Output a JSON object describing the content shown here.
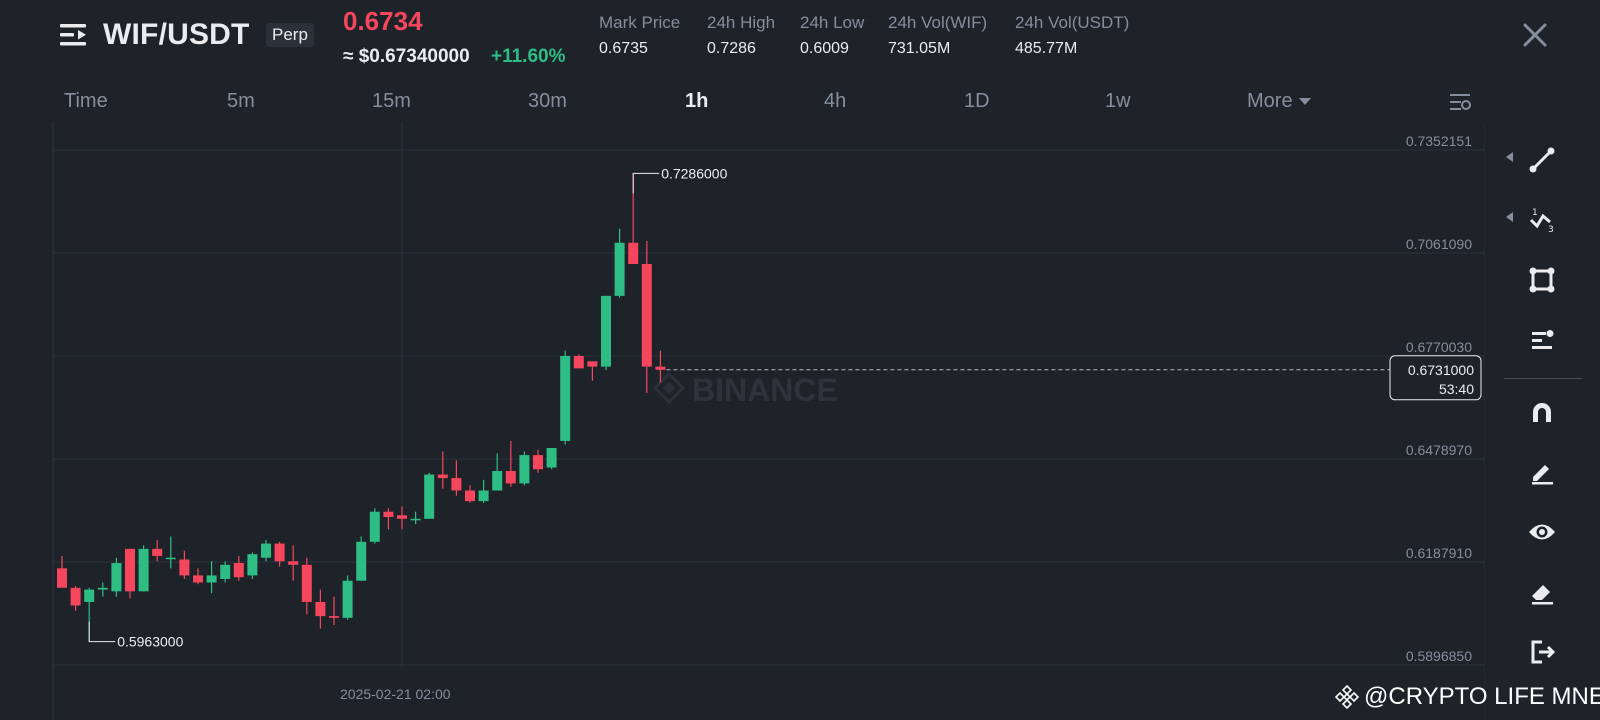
{
  "header": {
    "pair": "WIF/USDT",
    "contract_badge": "Perp",
    "last_price": "0.6734",
    "usd_price": "≈ $0.67340000",
    "change_pct": "+11.60%",
    "stats": [
      {
        "label": "Mark Price",
        "value": "0.6735"
      },
      {
        "label": "24h High",
        "value": "0.7286"
      },
      {
        "label": "24h Low",
        "value": "0.6009"
      },
      {
        "label": "24h Vol(WIF)",
        "value": "731.05M"
      },
      {
        "label": "24h Vol(USDT)",
        "value": "485.77M"
      }
    ]
  },
  "tabs": [
    {
      "label": "Time",
      "active": false
    },
    {
      "label": "5m",
      "active": false
    },
    {
      "label": "15m",
      "active": false
    },
    {
      "label": "30m",
      "active": false
    },
    {
      "label": "1h",
      "active": true
    },
    {
      "label": "4h",
      "active": false
    },
    {
      "label": "1D",
      "active": false
    },
    {
      "label": "1w",
      "active": false
    },
    {
      "label": "More",
      "active": false
    }
  ],
  "toolbar": {
    "tools": [
      "line-tool-icon",
      "fibonacci-tool-icon",
      "rectangle-tool-icon",
      "text-tool-icon",
      "magnet-icon",
      "pencil-icon",
      "eye-icon",
      "eraser-icon",
      "exit-icon"
    ]
  },
  "credit": "@CRYPTO LIFE MNE",
  "colors": {
    "up": "#2ebd85",
    "down": "#f6465d",
    "bg": "#1e2329",
    "grid": "#2b3139",
    "muted": "#848e9c"
  },
  "chart_data": {
    "type": "candlestick",
    "ylim": [
      0.589685,
      0.7352151
    ],
    "y_ticks": [
      "0.7352151",
      "0.7061090",
      "0.6770030",
      "0.6478970",
      "0.6187910",
      "0.5896850"
    ],
    "x_tick": "2025-02-21 02:00",
    "high_annotation": "0.7286000",
    "low_annotation": "0.5963000",
    "current_price": "0.6731000",
    "countdown": "53:40",
    "watermark": "BINANCE",
    "candles": [
      {
        "o": 0.617,
        "h": 0.6205,
        "l": 0.6125,
        "c": 0.6115
      },
      {
        "o": 0.6115,
        "h": 0.612,
        "l": 0.605,
        "c": 0.6065
      },
      {
        "o": 0.6075,
        "h": 0.6115,
        "l": 0.5963,
        "c": 0.611
      },
      {
        "o": 0.611,
        "h": 0.613,
        "l": 0.609,
        "c": 0.6115
      },
      {
        "o": 0.6105,
        "h": 0.62,
        "l": 0.609,
        "c": 0.6185
      },
      {
        "o": 0.6225,
        "h": 0.6225,
        "l": 0.6085,
        "c": 0.6105
      },
      {
        "o": 0.6105,
        "h": 0.6235,
        "l": 0.6105,
        "c": 0.6225
      },
      {
        "o": 0.6225,
        "h": 0.625,
        "l": 0.619,
        "c": 0.6205
      },
      {
        "o": 0.62,
        "h": 0.626,
        "l": 0.617,
        "c": 0.62
      },
      {
        "o": 0.6195,
        "h": 0.622,
        "l": 0.614,
        "c": 0.615
      },
      {
        "o": 0.615,
        "h": 0.617,
        "l": 0.6125,
        "c": 0.613
      },
      {
        "o": 0.613,
        "h": 0.619,
        "l": 0.61,
        "c": 0.615
      },
      {
        "o": 0.614,
        "h": 0.619,
        "l": 0.613,
        "c": 0.618
      },
      {
        "o": 0.6185,
        "h": 0.6205,
        "l": 0.6135,
        "c": 0.6145
      },
      {
        "o": 0.615,
        "h": 0.6215,
        "l": 0.614,
        "c": 0.621
      },
      {
        "o": 0.62,
        "h": 0.625,
        "l": 0.619,
        "c": 0.624
      },
      {
        "o": 0.624,
        "h": 0.6245,
        "l": 0.6175,
        "c": 0.619
      },
      {
        "o": 0.619,
        "h": 0.6235,
        "l": 0.6135,
        "c": 0.618
      },
      {
        "o": 0.618,
        "h": 0.62,
        "l": 0.604,
        "c": 0.6075
      },
      {
        "o": 0.6075,
        "h": 0.611,
        "l": 0.6,
        "c": 0.6035
      },
      {
        "o": 0.6035,
        "h": 0.609,
        "l": 0.601,
        "c": 0.603
      },
      {
        "o": 0.603,
        "h": 0.615,
        "l": 0.6025,
        "c": 0.6135
      },
      {
        "o": 0.6135,
        "h": 0.626,
        "l": 0.6135,
        "c": 0.6245
      },
      {
        "o": 0.6245,
        "h": 0.634,
        "l": 0.624,
        "c": 0.633
      },
      {
        "o": 0.633,
        "h": 0.634,
        "l": 0.628,
        "c": 0.6315
      },
      {
        "o": 0.632,
        "h": 0.6345,
        "l": 0.628,
        "c": 0.631
      },
      {
        "o": 0.631,
        "h": 0.633,
        "l": 0.6295,
        "c": 0.631
      },
      {
        "o": 0.631,
        "h": 0.644,
        "l": 0.631,
        "c": 0.6435
      },
      {
        "o": 0.6435,
        "h": 0.65,
        "l": 0.6395,
        "c": 0.6425
      },
      {
        "o": 0.6425,
        "h": 0.6475,
        "l": 0.6375,
        "c": 0.639
      },
      {
        "o": 0.639,
        "h": 0.6405,
        "l": 0.6355,
        "c": 0.636
      },
      {
        "o": 0.636,
        "h": 0.642,
        "l": 0.6355,
        "c": 0.639
      },
      {
        "o": 0.639,
        "h": 0.6495,
        "l": 0.639,
        "c": 0.6445
      },
      {
        "o": 0.6445,
        "h": 0.653,
        "l": 0.64,
        "c": 0.641
      },
      {
        "o": 0.641,
        "h": 0.65,
        "l": 0.6405,
        "c": 0.649
      },
      {
        "o": 0.649,
        "h": 0.6505,
        "l": 0.644,
        "c": 0.645
      },
      {
        "o": 0.6455,
        "h": 0.651,
        "l": 0.645,
        "c": 0.651
      },
      {
        "o": 0.653,
        "h": 0.6785,
        "l": 0.652,
        "c": 0.677
      },
      {
        "o": 0.677,
        "h": 0.6775,
        "l": 0.6735,
        "c": 0.6735
      },
      {
        "o": 0.6755,
        "h": 0.6755,
        "l": 0.67,
        "c": 0.674
      },
      {
        "o": 0.674,
        "h": 0.694,
        "l": 0.673,
        "c": 0.694
      },
      {
        "o": 0.694,
        "h": 0.713,
        "l": 0.6935,
        "c": 0.709
      },
      {
        "o": 0.709,
        "h": 0.7286,
        "l": 0.703,
        "c": 0.703
      },
      {
        "o": 0.703,
        "h": 0.7095,
        "l": 0.6665,
        "c": 0.674
      },
      {
        "o": 0.674,
        "h": 0.6785,
        "l": 0.6695,
        "c": 0.6731
      }
    ]
  }
}
